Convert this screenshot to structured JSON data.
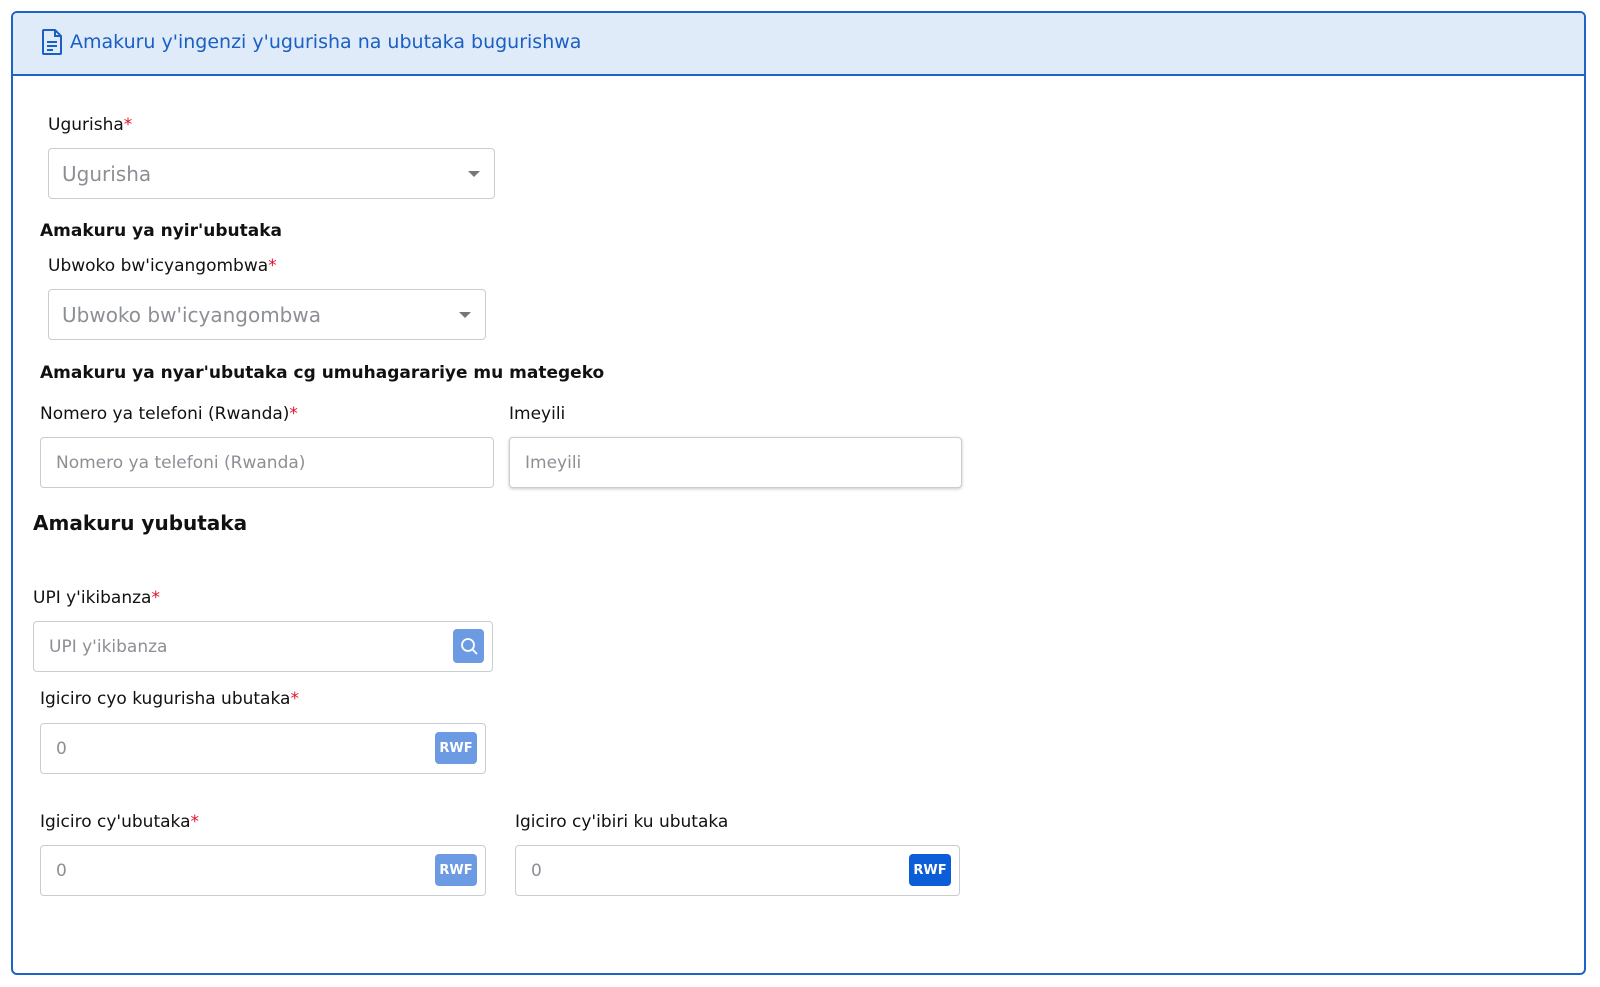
{
  "header": {
    "title": "Amakuru y'ingenzi y'ugurisha na ubutaka bugurishwa",
    "icon": "document-icon"
  },
  "seller": {
    "label": "Ugurisha",
    "value": "Ugurisha"
  },
  "owner_section": {
    "title": "Amakuru ya nyir'ubutaka"
  },
  "marital": {
    "label": "Ubwoko bw'icyangombwa",
    "value": "Ubwoko bw'icyangombwa"
  },
  "legal_section": {
    "title": "Amakuru ya nyar'ubutaka cg umuhagarariye mu mategeko"
  },
  "phone": {
    "label": "Nomero ya telefoni (Rwanda)",
    "placeholder": "Nomero ya telefoni (Rwanda)"
  },
  "email": {
    "label": "Imeyili",
    "placeholder": "Imeyili"
  },
  "land_section": {
    "title": "Amakuru yubutaka"
  },
  "upi": {
    "label": "UPI y'ikibanza",
    "placeholder": "UPI y'ikibanza"
  },
  "sale_price": {
    "label": "Igiciro cyo kugurisha ubutaka",
    "value": "0",
    "currency": "RWF"
  },
  "land_value": {
    "label": "Igiciro cy'ubutaka",
    "value": "0",
    "currency": "RWF"
  },
  "second_value": {
    "label": "Igiciro cy'ibiri ku ubutaka",
    "value": "0",
    "currency": "RWF"
  },
  "required_mark": "*",
  "colors": {
    "accent": "#1e64c8",
    "header_bg": "#dfebf8",
    "required": "#e0102b",
    "badge": "#6d9be3",
    "badge_dark": "#0b5ed7"
  }
}
